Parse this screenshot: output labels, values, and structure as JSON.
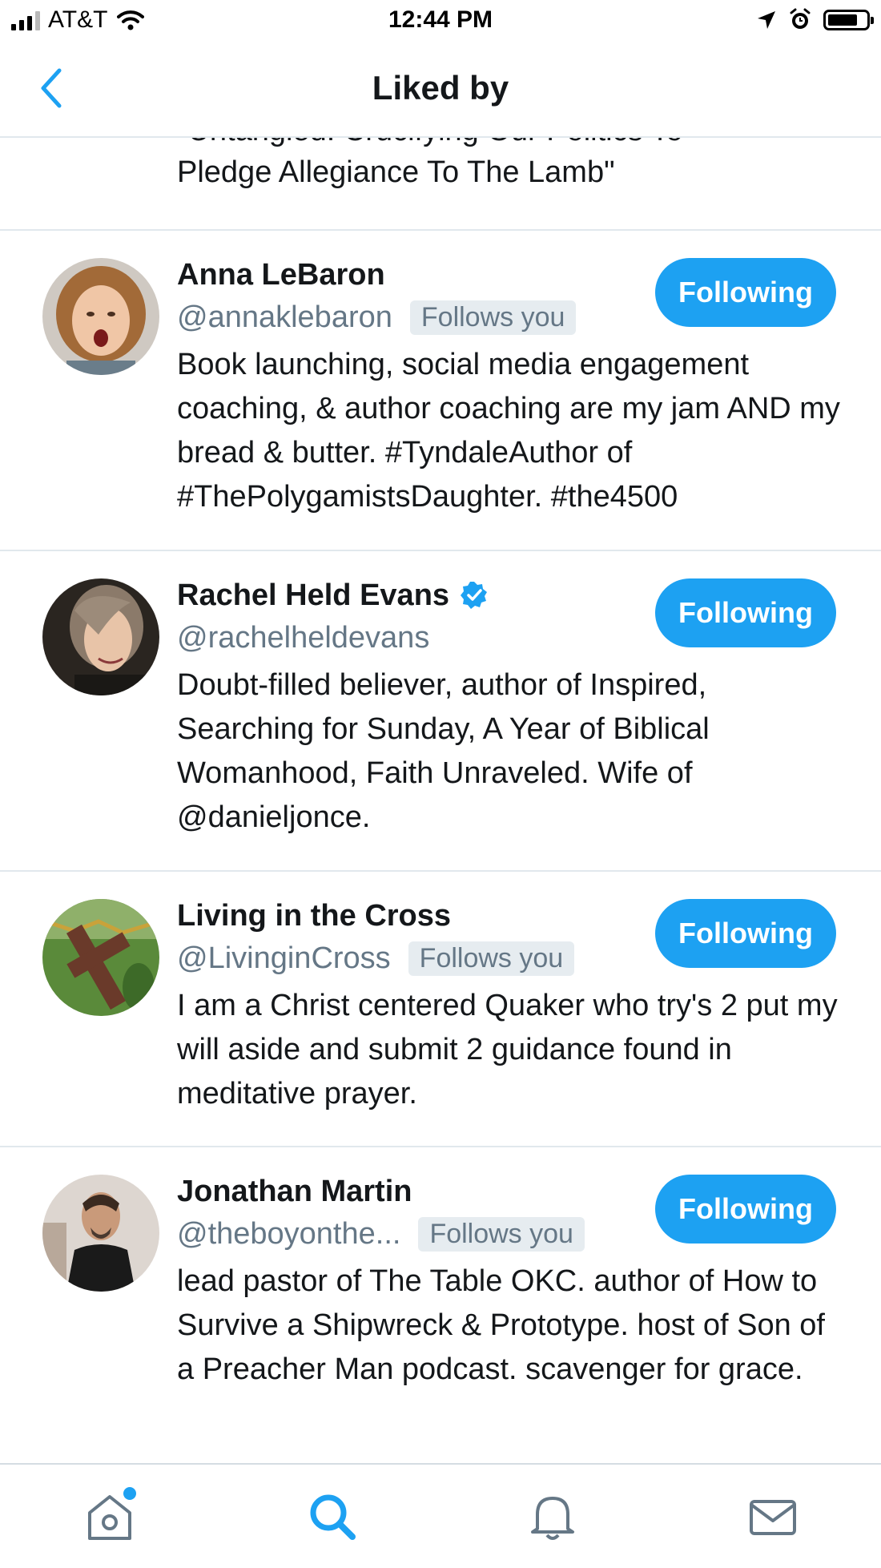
{
  "status_bar": {
    "carrier": "AT&T",
    "time": "12:44 PM"
  },
  "header": {
    "title": "Liked by",
    "back_icon": "chevron-left-icon"
  },
  "partial_row": {
    "clipped_text": "\"Untangled: Crucifying Our Politics To",
    "last_line": "Pledge Allegiance To The Lamb\""
  },
  "users": [
    {
      "name": "Anna LeBaron",
      "handle": "@annaklebaron",
      "follows_you": "Follows you",
      "verified": false,
      "button": "Following",
      "bio": "Book launching, social media engagement coaching, & author coaching are my jam AND my bread & butter. #TyndaleAuthor of #ThePolygamistsDaughter. #the4500"
    },
    {
      "name": "Rachel Held Evans",
      "handle": "@rachelheldevans",
      "follows_you": "",
      "verified": true,
      "button": "Following",
      "bio": "Doubt-filled believer, author of Inspired, Searching for Sunday, A Year of Biblical Womanhood, Faith Unraveled. Wife of @danieljonce."
    },
    {
      "name": "Living in the Cross",
      "handle": "@LivinginCross",
      "follows_you": "Follows you",
      "verified": false,
      "button": "Following",
      "bio": "I am a Christ centered Quaker who try's 2 put my will aside and submit 2 guidance found in meditative prayer."
    },
    {
      "name": "Jonathan Martin",
      "handle": "@theboyonthe...",
      "follows_you": "Follows you",
      "verified": false,
      "button": "Following",
      "bio": "lead pastor of The Table OKC. author of How to Survive a Shipwreck & Prototype. host of Son of a Preacher Man podcast. scavenger for grace."
    }
  ],
  "tab_bar": {
    "tabs": [
      "home-icon",
      "search-icon",
      "notifications-bell-icon",
      "messages-envelope-icon"
    ],
    "active": "search-icon"
  },
  "colors": {
    "accent": "#1da1f2",
    "handle_gray": "#657786",
    "badge_bg": "#e6ecf0",
    "divider": "#e1e8ed"
  }
}
